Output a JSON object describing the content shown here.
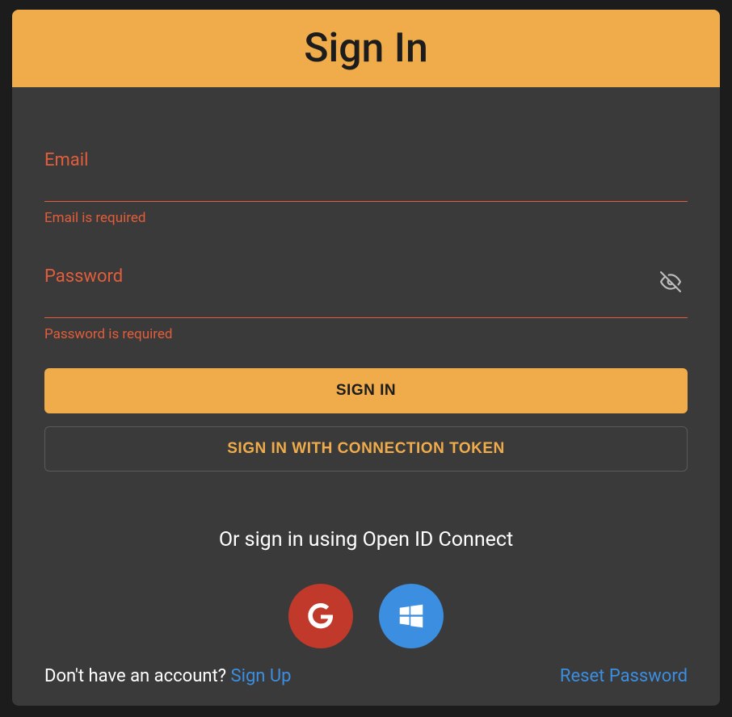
{
  "header": {
    "title": "Sign In"
  },
  "form": {
    "email": {
      "label": "Email",
      "value": "",
      "error": "Email is required"
    },
    "password": {
      "label": "Password",
      "value": "",
      "error": "Password is required"
    }
  },
  "buttons": {
    "signin": "SIGN IN",
    "token": "SIGN IN WITH CONNECTION TOKEN"
  },
  "oidc": {
    "text": "Or sign in using Open ID Connect",
    "providers": {
      "google": "google",
      "microsoft": "microsoft"
    }
  },
  "footer": {
    "prompt": "Don't have an account? ",
    "signup": "Sign Up",
    "reset": "Reset Password"
  },
  "colors": {
    "accent": "#f0ac4a",
    "error": "#e25d3a",
    "link": "#3b8ee0",
    "card": "#3a3a3a",
    "page": "#1c1c1c"
  }
}
